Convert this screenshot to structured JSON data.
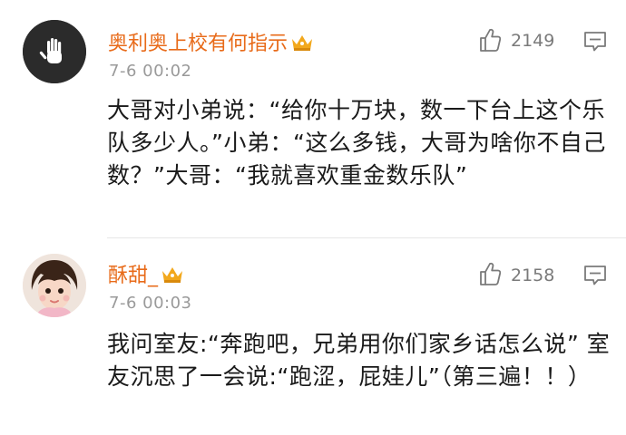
{
  "comments": [
    {
      "username": "奥利奥上校有何指示",
      "time": "7-6 00:02",
      "likes": "2149",
      "text": "大哥对小弟说：“给你十万块，数一下台上这个乐队多少人。”小弟：“这么多钱，大哥为啥你不自己数？”大哥：“我就喜欢重金数乐队”",
      "avatar_icon": "hand-avatar-icon",
      "badge_icon": "crown-icon"
    },
    {
      "username": "酥甜_",
      "time": "7-6 00:03",
      "likes": "2158",
      "text": "我问室友:“奔跑吧，兄弟用你们家乡话怎么说” 室友沉思了一会说:“跑涩，屁娃儿”（第三遍！！）",
      "avatar_icon": "girl-avatar-icon",
      "badge_icon": "crown-icon"
    }
  ],
  "colors": {
    "username": "#e86b1a",
    "crown": "#f2a81d",
    "meta": "#9a9a9a",
    "text": "#1a1a1a"
  }
}
